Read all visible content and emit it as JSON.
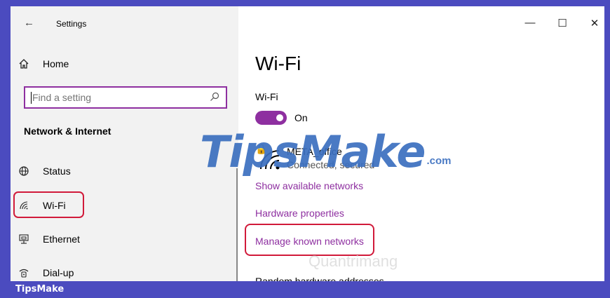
{
  "window": {
    "title": "Settings",
    "controls": {
      "minimize": "—",
      "maximize": "☐",
      "close": "✕"
    }
  },
  "sidebar": {
    "home": {
      "label": "Home",
      "icon": "home-icon"
    },
    "search": {
      "placeholder": "Find a setting",
      "icon": "search-icon"
    },
    "section_heading": "Network & Internet",
    "items": [
      {
        "label": "Status",
        "icon": "globe-icon"
      },
      {
        "label": "Wi-Fi",
        "icon": "wifi-icon"
      },
      {
        "label": "Ethernet",
        "icon": "ethernet-icon"
      },
      {
        "label": "Dial-up",
        "icon": "dialup-icon"
      }
    ]
  },
  "main": {
    "title": "Wi-Fi",
    "wifi_label": "Wi-Fi",
    "toggle_state": "On",
    "network": {
      "name": "META_office",
      "status": "Connected, secured"
    },
    "links": {
      "show_available": "Show available networks",
      "hardware": "Hardware properties",
      "manage_known": "Manage known networks"
    },
    "cutoff_text": "Random hardware addresses"
  },
  "colors": {
    "accent": "#8e2fa0",
    "highlight_box": "#d11a3a",
    "frame": "#4b4bbf"
  },
  "watermark": {
    "main": "TipsMake",
    "suffix": ".com",
    "secondary": "Quantrimang"
  },
  "footer": {
    "label": "TipsMake"
  }
}
